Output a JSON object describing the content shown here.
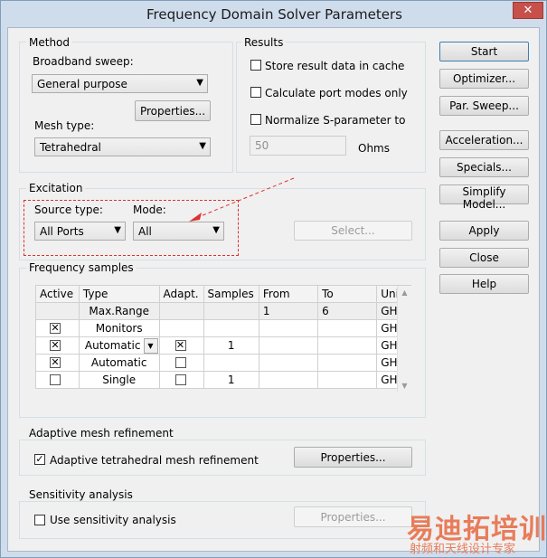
{
  "window": {
    "title": "Frequency Domain Solver Parameters",
    "close_glyph": "✕"
  },
  "method": {
    "group_label": "Method",
    "broadband_label": "Broadband sweep:",
    "broadband_value": "General purpose",
    "properties_label": "Properties...",
    "mesh_label": "Mesh type:",
    "mesh_value": "Tetrahedral"
  },
  "results": {
    "group_label": "Results",
    "store_cache_label": "Store result data in cache",
    "port_modes_label": "Calculate port modes only",
    "normalize_label": "Normalize S-parameter to",
    "ohms_value": "50",
    "ohms_unit": "Ohms"
  },
  "side_buttons": {
    "start": "Start",
    "optimizer": "Optimizer...",
    "par_sweep": "Par. Sweep...",
    "acceleration": "Acceleration...",
    "specials": "Specials...",
    "simplify_model": "Simplify Model...",
    "apply": "Apply",
    "close": "Close",
    "help": "Help"
  },
  "excitation": {
    "group_label": "Excitation",
    "source_type_label": "Source type:",
    "source_type_value": "All Ports",
    "mode_label": "Mode:",
    "mode_value": "All",
    "select_label": "Select..."
  },
  "frequency_samples": {
    "group_label": "Frequency samples",
    "columns": [
      "Active",
      "Type",
      "Adapt.",
      "Samples",
      "From",
      "To",
      "Unit"
    ],
    "rows": [
      {
        "active": "",
        "type": "Max.Range",
        "adapt": "",
        "samples": "",
        "from": "1",
        "to": "6",
        "unit": "GHz"
      },
      {
        "active": "checked",
        "type": "Monitors",
        "adapt": "",
        "samples": "",
        "from": "",
        "to": "",
        "unit": "GHz"
      },
      {
        "active": "checked",
        "type": "Automatic",
        "adapt": "checked",
        "samples": "1",
        "from": "",
        "to": "",
        "unit": "GHz"
      },
      {
        "active": "checked",
        "type": "Automatic",
        "adapt": "unchecked",
        "samples": "",
        "from": "",
        "to": "",
        "unit": "GHz"
      },
      {
        "active": "unchecked",
        "type": "Single",
        "adapt": "unchecked",
        "samples": "1",
        "from": "",
        "to": "",
        "unit": "GHz"
      }
    ]
  },
  "adaptive_mesh": {
    "group_label": "Adaptive mesh refinement",
    "checkbox_label": "Adaptive tetrahedral mesh refinement",
    "checked": true,
    "properties_label": "Properties..."
  },
  "sensitivity": {
    "group_label": "Sensitivity analysis",
    "checkbox_label": "Use sensitivity analysis",
    "checked": false,
    "properties_label": "Properties..."
  },
  "watermark": {
    "big": "易迪拓培训",
    "small": "射频和天线设计专家"
  },
  "colors": {
    "annotation": "#e03030",
    "watermark": "#e8704a",
    "title_close": "#c7504a"
  }
}
